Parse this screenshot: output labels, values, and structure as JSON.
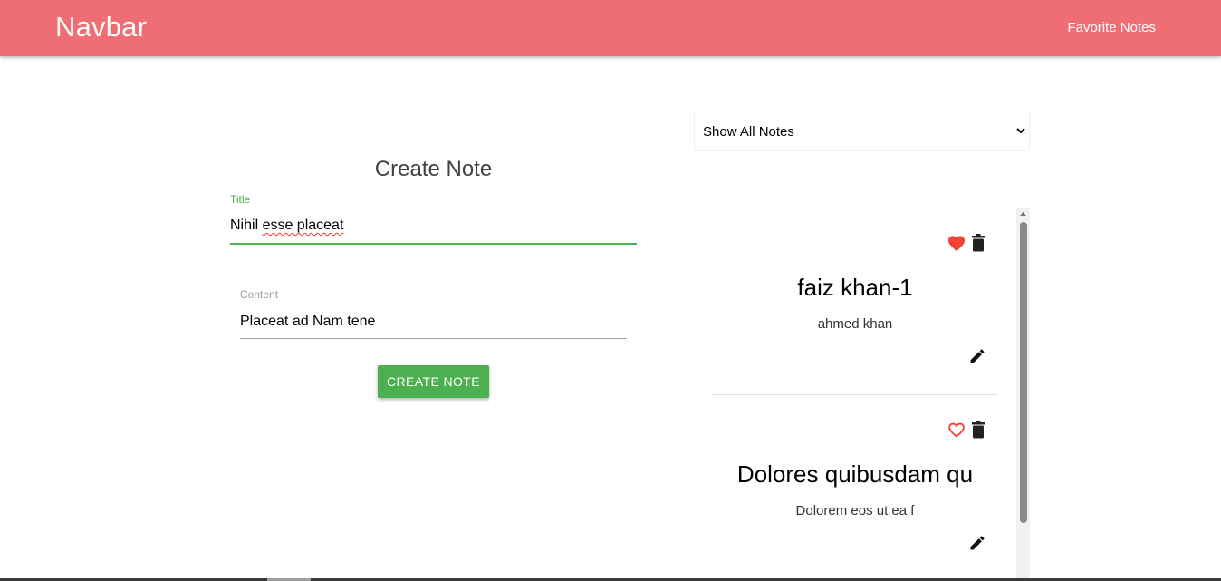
{
  "navbar": {
    "brand": "Navbar",
    "link": "Favorite Notes",
    "color": "#ee6e73"
  },
  "form": {
    "heading": "Create Note",
    "title_label": "Title",
    "title_value_pre": "Nihil ",
    "title_value_misspelled": "esse placeat",
    "content_label": "Content",
    "content_value": "Placeat ad Nam tene",
    "submit_label": "CREATE NOTE",
    "accent": "#4caf50"
  },
  "filter": {
    "selected": "Show All Notes",
    "icon": "chevron-down-icon"
  },
  "notes": [
    {
      "title": "faiz khan-1",
      "content": "ahmed khan",
      "favorite": true,
      "favorite_icon": "heart-filled-icon",
      "delete_icon": "trash-icon",
      "edit_icon": "pencil-icon"
    },
    {
      "title": "Dolores quibusdam qu",
      "content": "Dolorem eos ut ea f",
      "favorite": false,
      "favorite_icon": "heart-outline-icon",
      "delete_icon": "trash-icon",
      "edit_icon": "pencil-icon"
    }
  ],
  "colors": {
    "heart": "#f44336"
  }
}
